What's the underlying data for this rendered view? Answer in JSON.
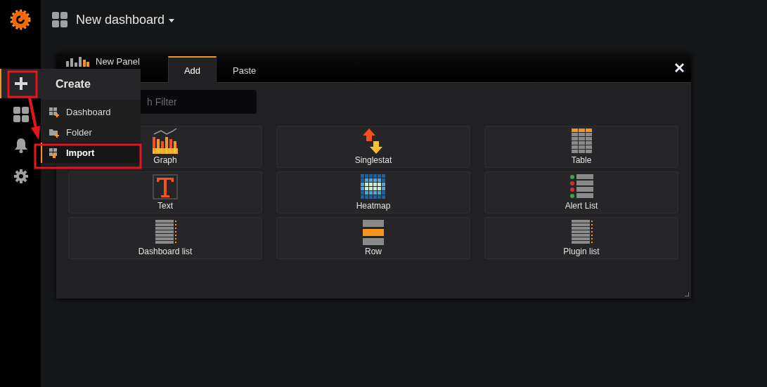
{
  "sidebar": {
    "items": [
      {
        "kind": "create",
        "selected": true
      },
      {
        "kind": "dashboards",
        "selected": false
      },
      {
        "kind": "alerting",
        "selected": false
      },
      {
        "kind": "configuration",
        "selected": false
      }
    ]
  },
  "header": {
    "title": "New dashboard"
  },
  "panel": {
    "title": "New Panel",
    "tabs": [
      {
        "label": "Add",
        "selected": true
      },
      {
        "label": "Paste",
        "selected": false
      }
    ],
    "search": {
      "placeholder": "h Filter"
    },
    "types": [
      {
        "label": "Graph",
        "kind": "graph"
      },
      {
        "label": "Singlestat",
        "kind": "singlestat"
      },
      {
        "label": "Table",
        "kind": "table"
      },
      {
        "label": "Text",
        "kind": "text"
      },
      {
        "label": "Heatmap",
        "kind": "heatmap"
      },
      {
        "label": "Alert List",
        "kind": "alertlist"
      },
      {
        "label": "Dashboard list",
        "kind": "dashlist"
      },
      {
        "label": "Row",
        "kind": "row"
      },
      {
        "label": "Plugin list",
        "kind": "pluginlist"
      }
    ]
  },
  "menu": {
    "title": "Create",
    "items": [
      {
        "label": "Dashboard",
        "kind": "dashboard",
        "selected": false
      },
      {
        "label": "Folder",
        "kind": "folder",
        "selected": false
      },
      {
        "label": "Import",
        "kind": "import",
        "selected": true
      }
    ]
  }
}
